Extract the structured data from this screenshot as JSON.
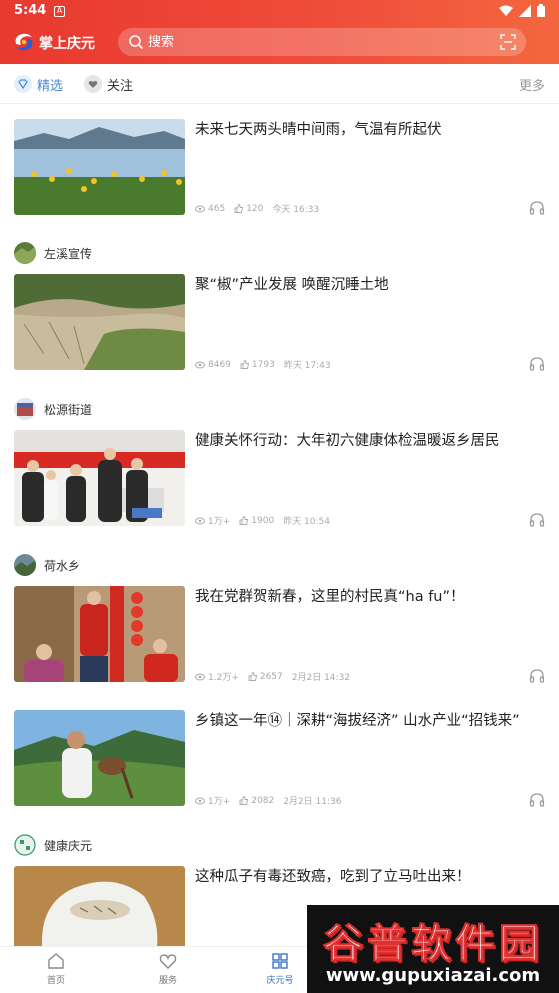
{
  "status_bar": {
    "time": "5:44",
    "notification_badge": "A"
  },
  "app": {
    "title": "掌上庆元"
  },
  "search": {
    "placeholder": "搜索"
  },
  "tabs": {
    "items": [
      {
        "label": "精选",
        "icon": "diamond-icon",
        "active": true
      },
      {
        "label": "关注",
        "icon": "heart-shield-icon",
        "active": false
      }
    ],
    "more_label": "更多"
  },
  "feed": {
    "cards": [
      {
        "source": "",
        "title": "未来七天两头晴中间雨，气温有所起伏",
        "views": "465",
        "likes": "120",
        "time": "今天 16:33"
      },
      {
        "source": "左溪宣传",
        "title": "聚“椒”产业发展 唤醒沉睡土地",
        "views": "8469",
        "likes": "1793",
        "time": "昨天 17:43"
      },
      {
        "source": "松源街道",
        "title": " 健康关怀行动：大年初六健康体检温暖返乡居民",
        "views": "1万+",
        "likes": "1900",
        "time": "昨天 10:54"
      },
      {
        "source": "荷水乡",
        "title": "我在党群贺新春，这里的村民真“ha fu”！",
        "views": "1.2万+",
        "likes": "2657",
        "time": "2月2日 14:32"
      },
      {
        "source": "",
        "title": "乡镇这一年⑭｜深耕“海拔经济” 山水产业“招钱来”",
        "views": "1万+",
        "likes": "2082",
        "time": "2月2日 11:36"
      },
      {
        "source": "健康庆元",
        "title": "这种瓜子有毒还致癌，吃到了立马吐出来！",
        "views": "",
        "likes": "",
        "time": ""
      }
    ]
  },
  "bottom_nav": {
    "items": [
      {
        "label": "首页",
        "icon": "home-icon",
        "active": false
      },
      {
        "label": "服务",
        "icon": "heart-icon",
        "active": false
      },
      {
        "label": "庆元号",
        "icon": "grid-icon",
        "active": true
      }
    ]
  },
  "watermark": {
    "text": "谷普软件园",
    "url": "www.gupuxiazai.com"
  },
  "colors": {
    "header": "#ea3d31",
    "accent_blue": "#4a8ad8",
    "active_nav": "#3f74c8"
  }
}
